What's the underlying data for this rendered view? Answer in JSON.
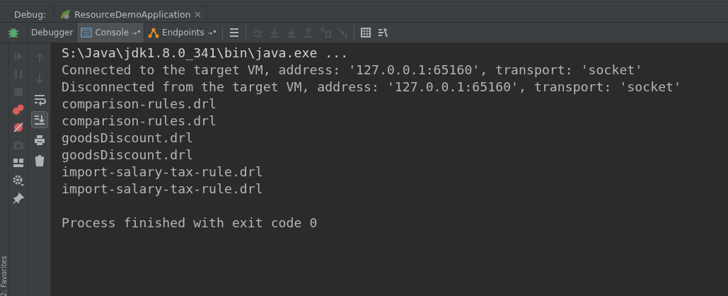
{
  "debug_label": "Debug:",
  "run_tab": {
    "label": "ResourceDemoApplication",
    "closable": true
  },
  "tabs": [
    {
      "label": "Debugger",
      "selected": false,
      "kind": "plain"
    },
    {
      "label": "Console",
      "selected": true,
      "kind": "console"
    },
    {
      "label": "Endpoints",
      "selected": false,
      "kind": "endpoints"
    }
  ],
  "toolbar_icons": [
    {
      "kind": "menu",
      "disabled": false
    },
    {
      "kind": "step-over",
      "disabled": true
    },
    {
      "kind": "step-into",
      "disabled": true
    },
    {
      "kind": "force-step-into",
      "disabled": true
    },
    {
      "kind": "step-out",
      "disabled": true
    },
    {
      "kind": "drop-frame",
      "disabled": true
    },
    {
      "kind": "run-to-cursor",
      "disabled": true
    },
    {
      "kind": "evaluate",
      "disabled": false
    },
    {
      "kind": "trace",
      "disabled": false
    }
  ],
  "side_icons": [
    {
      "kind": "resume",
      "disabled": true
    },
    {
      "kind": "pause",
      "disabled": true
    },
    {
      "kind": "stop",
      "disabled": true
    },
    {
      "kind": "breakpoints",
      "disabled": false
    },
    {
      "kind": "mute",
      "disabled": false
    },
    {
      "kind": "camera",
      "disabled": true
    },
    {
      "kind": "layout",
      "disabled": false
    },
    {
      "kind": "gear",
      "disabled": false
    },
    {
      "kind": "pin",
      "disabled": false
    }
  ],
  "console_icons": [
    {
      "kind": "up",
      "disabled": true,
      "selected": false
    },
    {
      "kind": "down",
      "disabled": true,
      "selected": false
    },
    {
      "kind": "wrap",
      "disabled": false,
      "selected": false
    },
    {
      "kind": "scroll-end",
      "disabled": false,
      "selected": true
    },
    {
      "kind": "print",
      "disabled": false,
      "selected": false
    },
    {
      "kind": "trash",
      "disabled": false,
      "selected": false
    }
  ],
  "console_lines": [
    {
      "text": "S:\\Java\\jdk1.8.0_341\\bin\\java.exe ...",
      "kind": "command"
    },
    {
      "text": "Connected to the target VM, address: '127.0.0.1:65160', transport: 'socket'",
      "kind": "output"
    },
    {
      "text": "Disconnected from the target VM, address: '127.0.0.1:65160', transport: 'socket'",
      "kind": "output"
    },
    {
      "text": "comparison-rules.drl",
      "kind": "output"
    },
    {
      "text": "comparison-rules.drl",
      "kind": "output"
    },
    {
      "text": "goodsDiscount.drl",
      "kind": "output"
    },
    {
      "text": "goodsDiscount.drl",
      "kind": "output"
    },
    {
      "text": "import-salary-tax-rule.drl",
      "kind": "output"
    },
    {
      "text": "import-salary-tax-rule.drl",
      "kind": "output"
    },
    {
      "kind": "blank"
    },
    {
      "text": "Process finished with exit code 0",
      "kind": "output"
    }
  ],
  "favorites_label": "2: Favorites"
}
